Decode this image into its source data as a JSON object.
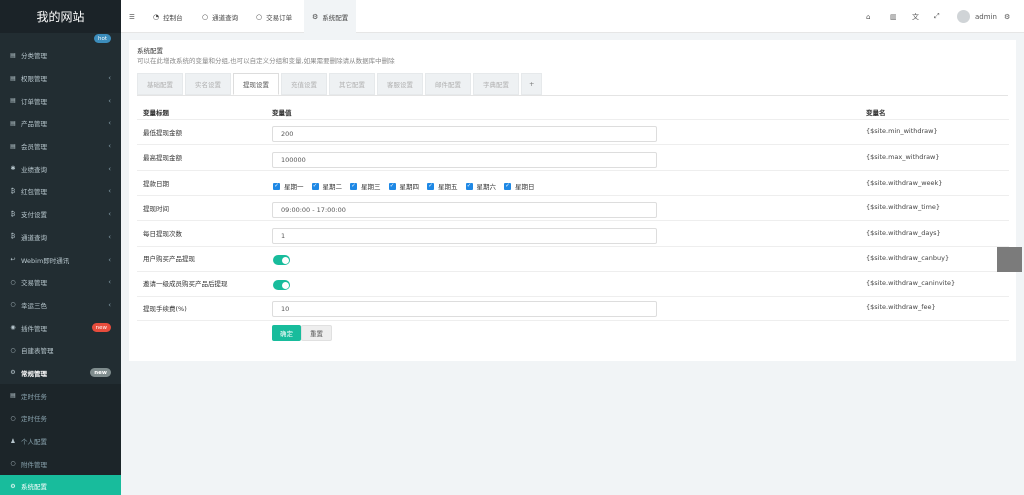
{
  "app": {
    "title": "我的网站"
  },
  "sidebar": {
    "top_badge": "hot",
    "items": [
      {
        "label": "分类管理",
        "icon": "list-icon",
        "arrow": ""
      },
      {
        "label": "权限管理",
        "icon": "group-icon",
        "arrow": "‹"
      },
      {
        "label": "订单管理",
        "icon": "list-icon",
        "arrow": "‹"
      },
      {
        "label": "产品管理",
        "icon": "list-icon",
        "arrow": "‹"
      },
      {
        "label": "会员管理",
        "icon": "list-icon",
        "arrow": "‹"
      },
      {
        "label": "业绩查询",
        "icon": "gear-icon",
        "arrow": "‹"
      },
      {
        "label": "红包管理",
        "icon": "bitcoin-icon",
        "arrow": "‹"
      },
      {
        "label": "支付设置",
        "icon": "bitcoin-icon",
        "arrow": "‹"
      },
      {
        "label": "通道查询",
        "icon": "bitcoin-icon",
        "arrow": "‹"
      },
      {
        "label": "Webim即时通讯",
        "icon": "undo-icon",
        "arrow": "‹"
      },
      {
        "label": "交易管理",
        "icon": "circle-icon",
        "arrow": "‹"
      },
      {
        "label": "幸运三色",
        "icon": "circle-icon",
        "arrow": "‹"
      },
      {
        "label": "插件管理",
        "icon": "rocket-icon",
        "badge": "new"
      },
      {
        "label": "自建表管理",
        "icon": "circle-icon",
        "arrow": ""
      },
      {
        "label": "常规管理",
        "icon": "cogs-icon",
        "badge": "new"
      },
      {
        "label": "定时任务",
        "icon": "list-icon"
      },
      {
        "label": "定时任务",
        "icon": "circle-icon"
      },
      {
        "label": "个人配置",
        "icon": "user-icon"
      },
      {
        "label": "附件管理",
        "icon": "circle-icon"
      },
      {
        "label": "系统配置",
        "icon": "cogs-icon"
      }
    ]
  },
  "topbar": {
    "menu_icon": "hamburger-icon",
    "tabs": [
      {
        "label": "控制台",
        "icon": "dashboard-icon"
      },
      {
        "label": "通道查询",
        "icon": "circle-icon"
      },
      {
        "label": "交易订单",
        "icon": "circle-icon"
      },
      {
        "label": "系统配置",
        "icon": "cogs-icon"
      }
    ],
    "user": "admin"
  },
  "config": {
    "title": "系统配置",
    "description": "可以在此增改系统的变量和分组,也可以自定义分组和变量,如果需要删除请从数据库中删除",
    "tabs": [
      "基础配置",
      "实名设置",
      "提现设置",
      "充值设置",
      "其它配置",
      "客服设置",
      "邮件配置",
      "字典配置",
      "+"
    ],
    "active_tab": 2,
    "columns": {
      "title": "变量标题",
      "value": "变量值",
      "name": "变量名"
    },
    "rows": [
      {
        "title": "最低提现金额",
        "type": "input",
        "value": "200",
        "name": "{$site.min_withdraw}"
      },
      {
        "title": "最高提现金额",
        "type": "input",
        "value": "100000",
        "name": "{$site.max_withdraw}"
      },
      {
        "title": "提款日期",
        "type": "checks",
        "options": [
          "星期一",
          "星期二",
          "星期三",
          "星期四",
          "星期五",
          "星期六",
          "星期日"
        ],
        "name": "{$site.withdraw_week}"
      },
      {
        "title": "提现时间",
        "type": "input",
        "value": "09:00:00 - 17:00:00",
        "name": "{$site.withdraw_time}"
      },
      {
        "title": "每日提现次数",
        "type": "input",
        "value": "1",
        "name": "{$site.withdraw_days}"
      },
      {
        "title": "用户购买产品提现",
        "type": "toggle",
        "checked": true,
        "name": "{$site.withdraw_canbuy}"
      },
      {
        "title": "邀请一级成员购买产品后提现",
        "type": "toggle",
        "checked": true,
        "name": "{$site.withdraw_caninvite}"
      },
      {
        "title": "提现手续费(%)",
        "type": "input",
        "value": "10",
        "name": "{$site.withdraw_fee}"
      }
    ],
    "submit_label": "确定",
    "reset_label": "重置"
  },
  "colors": {
    "accent": "#18bc9c",
    "sidebar": "#222d32"
  }
}
